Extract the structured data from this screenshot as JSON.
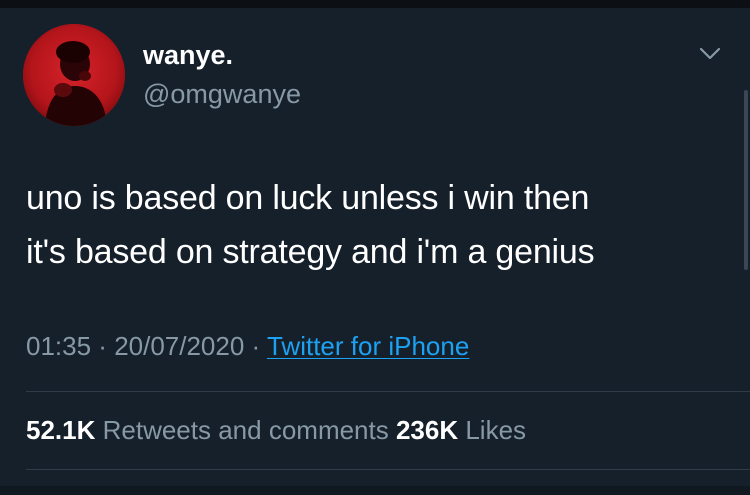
{
  "tweet": {
    "display_name": "wanye.",
    "handle": "@omgwanye",
    "text_line_1": "uno is based on luck unless i win then",
    "text_line_2": "it's based on strategy and i'm a genius",
    "time": "01:35",
    "separator_1": " · ",
    "date": "20/07/2020",
    "separator_2": " · ",
    "source": "Twitter for iPhone",
    "retweets_count": "52.1K",
    "retweets_label": " Retweets and comments ",
    "likes_count": "236K",
    "likes_label": " Likes"
  },
  "icons": {
    "more_options": "chevron-down-icon",
    "avatar": "user-avatar"
  },
  "colors": {
    "background": "#15202b",
    "primary_text": "#ffffff",
    "secondary_text": "#8899a6",
    "link": "#1da1f2",
    "divider": "#2f3b47",
    "avatar_red": "#b0151a"
  }
}
